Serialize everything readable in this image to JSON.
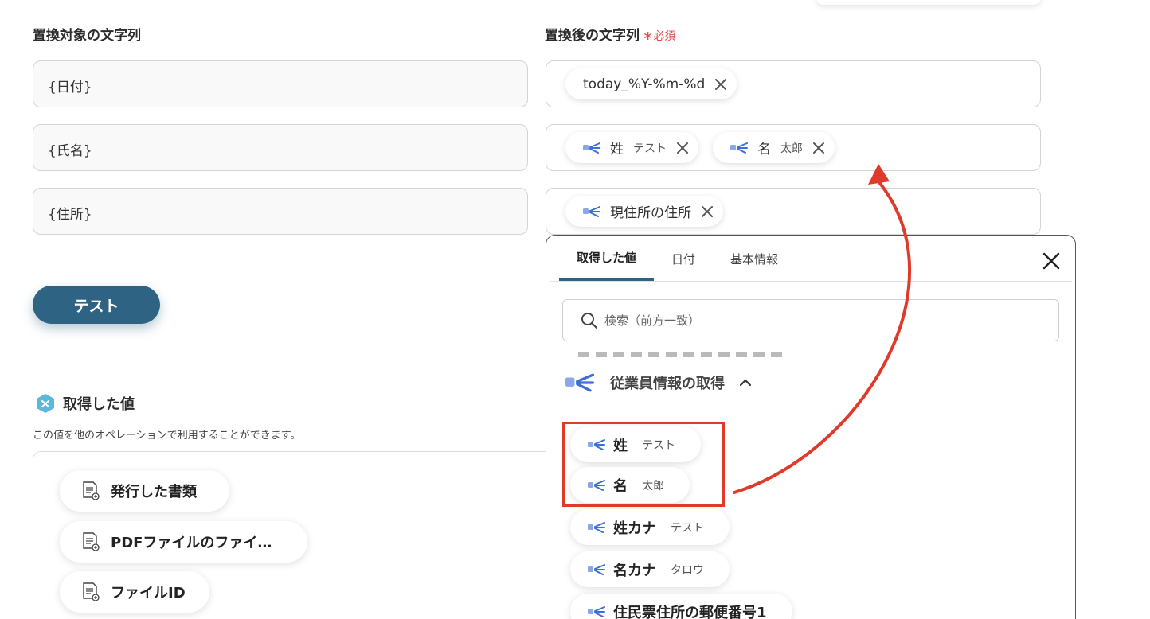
{
  "left_column": {
    "title": "置換対象の文字列",
    "fields": [
      "{日付}",
      "{氏名}",
      "{住所}"
    ]
  },
  "right_column": {
    "title": "置換後の文字列",
    "required_mark": "∗",
    "required_text": "必須",
    "row1_chip": {
      "label": "today_%Y-%m-%d"
    },
    "row2_chips": [
      {
        "label": "姓",
        "sub": "テスト"
      },
      {
        "label": "名",
        "sub": "太郎"
      }
    ],
    "row3_chip": {
      "label": "現住所の住所"
    }
  },
  "test_button": "テスト",
  "output_section": {
    "title": "取得した値",
    "description": "この値を他のオペレーションで利用することができます。",
    "items": [
      "発行した書類",
      "PDFファイルのファイ…",
      "ファイルID"
    ]
  },
  "popup": {
    "tabs": [
      "取得した値",
      "日付",
      "基本情報"
    ],
    "search_placeholder": "検索（前方一致）",
    "group_title": "従業員情報の取得",
    "items": [
      {
        "label": "姓",
        "sub": "テスト"
      },
      {
        "label": "名",
        "sub": "太郎"
      },
      {
        "label": "姓カナ",
        "sub": "テスト"
      },
      {
        "label": "名カナ",
        "sub": "タロウ"
      },
      {
        "label": "住民票住所の郵便番号1",
        "sub": ""
      }
    ]
  },
  "colors": {
    "accent": "#2f6383",
    "required_red": "#e5484d",
    "highlight_red": "#e03a2a",
    "icon_blue": "#4a76d6"
  }
}
